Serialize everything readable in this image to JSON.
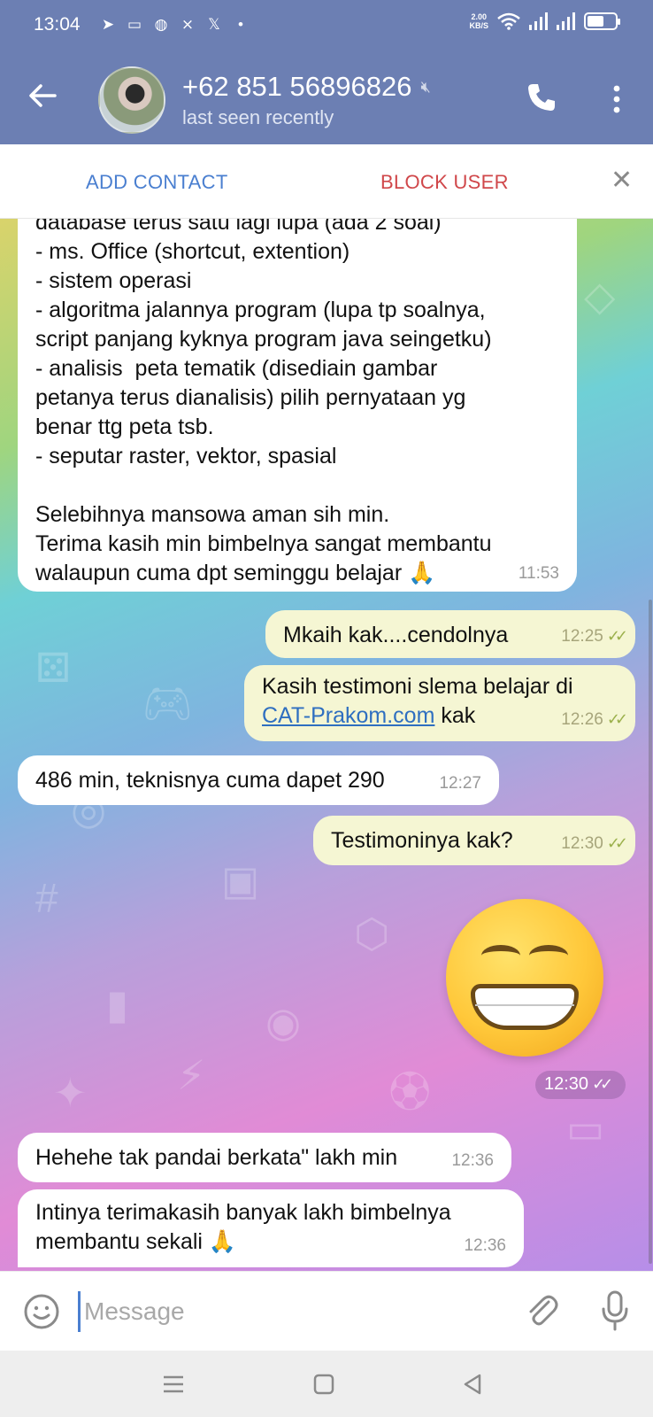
{
  "status_bar": {
    "time": "13:04",
    "speed": "2.00",
    "speed_unit": "KB/S",
    "notification_icons": [
      "telegram-icon",
      "screen-icon",
      "app-icon",
      "app2-icon",
      "x-icon",
      "dot-icon"
    ]
  },
  "header": {
    "title": "+62 851 56896826",
    "subtitle": "last seen recently"
  },
  "action_bar": {
    "add_contact": "ADD CONTACT",
    "block_user": "BLOCK USER"
  },
  "messages": {
    "m1": {
      "lines": [
        "database terus satu lagi lupa (ada 2 soal)",
        "- ms. Office (shortcut, extention)",
        "- sistem operasi",
        "- algoritma jalannya program (lupa tp soalnya,",
        "script panjang kyknya program java seingetku)",
        "- analisis  peta tematik (disediain gambar",
        "petanya terus dianalisis) pilih pernyataan yg",
        "benar ttg peta tsb.",
        "- seputar raster, vektor, spasial",
        "",
        "Selebihnya mansowa aman sih min.",
        "Terima kasih min bimbelnya sangat membantu",
        "walaupun cuma dpt seminggu belajar 🙏"
      ],
      "time": "11:53"
    },
    "m2": {
      "text": "Mkaih kak....cendolnya",
      "time": "12:25"
    },
    "m3": {
      "text_before": "Kasih testimoni slema belajar di",
      "link": "CAT-Prakom.com",
      "text_after": " kak",
      "time": "12:26"
    },
    "m4": {
      "text": "486 min, teknisnya cuma dapet 290",
      "time": "12:27"
    },
    "m5": {
      "text": "Testimoninya kak?",
      "time": "12:30"
    },
    "m6": {
      "sticker": "grinning-face-emoji",
      "time": "12:30"
    },
    "m7": {
      "text": "Hehehe tak pandai berkata\" lakh min",
      "time": "12:36"
    },
    "m8": {
      "line1": "Intinya terimakasih banyak lakh bimbelnya",
      "line2": "membantu sekali 🙏",
      "time": "12:36"
    }
  },
  "composer": {
    "placeholder": "Message"
  },
  "colors": {
    "header_bg": "#6c7fb3",
    "add_contact": "#4a7fd0",
    "block_user": "#d0474a",
    "outgoing_bubble": "#f5f6d3",
    "incoming_bubble": "#ffffff"
  }
}
